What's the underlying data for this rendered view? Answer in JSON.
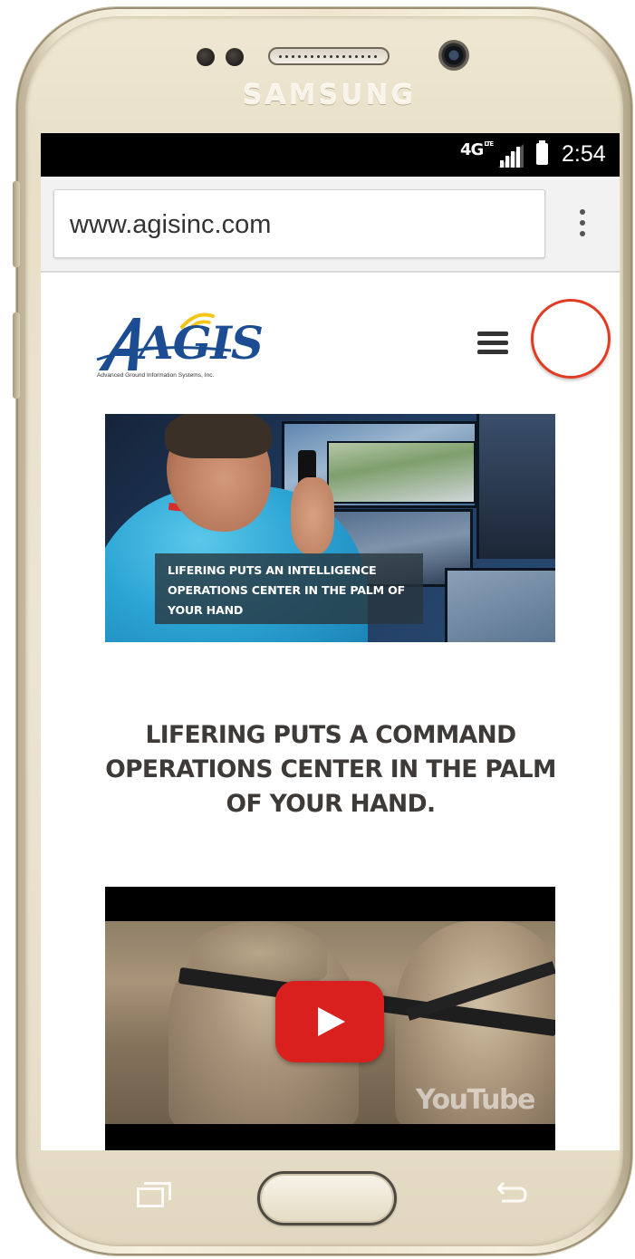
{
  "device": {
    "brand": "SAMSUNG"
  },
  "status_bar": {
    "network": "4G",
    "network_sub": "LTE",
    "time": "2:54"
  },
  "browser": {
    "url": "www.agisinc.com",
    "menu_icon": "more-vert-icon"
  },
  "site": {
    "logo": {
      "wordmark": "AGIS",
      "tagline": "Advanced Ground Information Systems, Inc."
    },
    "nav_menu_icon": "hamburger-menu-icon",
    "hero": {
      "caption": "LIFERING PUTS AN INTELLIGENCE OPERATIONS CENTER IN THE PALM OF YOUR HAND"
    },
    "headline": "LIFERING PUTS A COMMAND OPERATIONS CENTER IN THE PALM OF YOUR HAND.",
    "video": {
      "play_icon": "play-icon",
      "watermark": "YouTube"
    }
  },
  "colors": {
    "status_bar": "#000000",
    "browser_bar": "#f2f2f2",
    "logo_blue": "#1c4c92",
    "logo_accent": "#f5c518",
    "headline_text": "#3e3a38",
    "play_button": "#d9201f",
    "highlight_ring": "#e23b22"
  }
}
